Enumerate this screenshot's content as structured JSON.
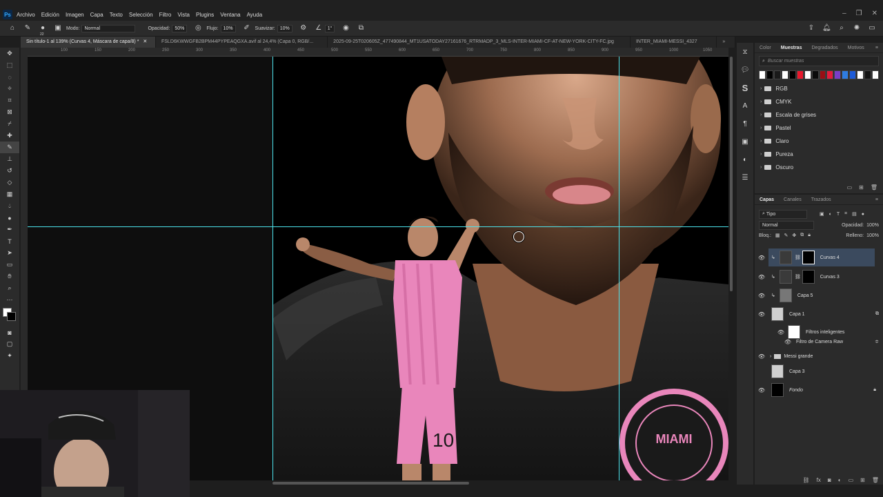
{
  "menu": {
    "items": [
      "Archivo",
      "Edición",
      "Imagen",
      "Capa",
      "Texto",
      "Selección",
      "Filtro",
      "Vista",
      "Plugins",
      "Ventana",
      "Ayuda"
    ]
  },
  "options": {
    "brush_size": "22",
    "mode_label": "Modo:",
    "mode_value": "Normal",
    "opacity_label": "Opacidad:",
    "opacity_value": "50%",
    "flow_label": "Flujo:",
    "flow_value": "10%",
    "smooth_label": "Suavizar:",
    "smooth_value": "10%",
    "angle_value": "1°"
  },
  "tabs": [
    "Sin título-1 al 139% (Curvas 4, Máscara de capa/8) *",
    "FSLD6KWWGFB2BPM44PYPEAQGXA.avif al 24,4% (Capa 0, RGB/...",
    "2025-09-25T020605Z_477490844_MT1USATODAY27161676_RTRMADP_3_MLS-INTER-MIAMI-CF-AT-NEW-YORK-CITY-FC.jpg",
    "INTER_MIAMI-MESSI_4327"
  ],
  "rulers": {
    "top": [
      "100",
      "150",
      "200",
      "250",
      "300",
      "350",
      "400",
      "450",
      "500",
      "550",
      "600",
      "650",
      "700",
      "750",
      "800",
      "850",
      "900",
      "950",
      "1000",
      "1050"
    ]
  },
  "swatches": {
    "tabs": [
      "Color",
      "Muestras",
      "Degradados",
      "Motivos"
    ],
    "active_tab": "Muestras",
    "search_placeholder": "Buscar muestras",
    "colors": [
      "#ffffff",
      "#000000",
      "#1a1a1a",
      "#ffffff",
      "#000000",
      "#e8182c",
      "#ffffff",
      "#0a0a0a",
      "#9a0e14",
      "#e41c3c",
      "#7a3ec8",
      "#2f7de1",
      "#1d5bd8",
      "#ffffff",
      "#141414",
      "#ffffff"
    ],
    "folders": [
      "RGB",
      "CMYK",
      "Escala de grises",
      "Pastel",
      "Claro",
      "Pureza",
      "Oscuro"
    ]
  },
  "layers_panel": {
    "tabs": [
      "Capas",
      "Canales",
      "Trazados"
    ],
    "active_tab": "Capas",
    "filter_value": "Tipo",
    "blend_mode": "Normal",
    "opacity_label": "Opacidad:",
    "opacity_value": "100%",
    "lock_label": "Bloq.:",
    "fill_label": "Relleno:",
    "fill_value": "100%",
    "layers": [
      {
        "name": "Curvas 4",
        "selected": true
      },
      {
        "name": "Curvas 3",
        "selected": false
      },
      {
        "name": "Capa 5",
        "selected": false
      },
      {
        "name": "Capa 1",
        "selected": false
      },
      {
        "name": "Filtros inteligentes",
        "selected": false
      },
      {
        "name": "Filtro de Camera Raw",
        "selected": false
      },
      {
        "name": "Messi grande",
        "selected": false
      },
      {
        "name": "Capa 3",
        "selected": false
      },
      {
        "name": "Fondo",
        "selected": false
      }
    ]
  },
  "colors": {
    "accent": "#31a8ff",
    "guide": "#4de3ec",
    "selected_layer": "#3b4a5e",
    "jersey_pink": "#e986bb"
  }
}
